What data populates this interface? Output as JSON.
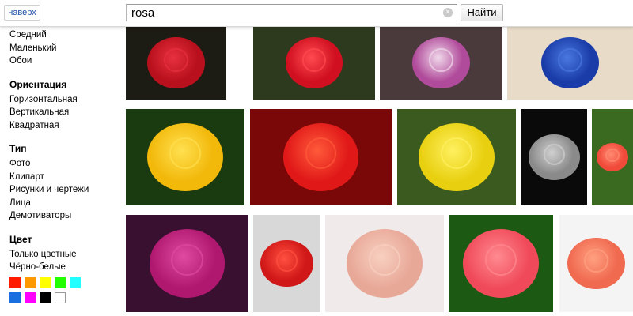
{
  "header": {
    "up_label": "наверх",
    "search_value": "rosa",
    "clear_glyph": "×",
    "search_button": "Найти"
  },
  "sidebar": {
    "size_items": [
      "Средний",
      "Маленький",
      "Обои"
    ],
    "orientation": {
      "title": "Ориентация",
      "items": [
        "Горизонтальная",
        "Вертикальная",
        "Квадратная"
      ]
    },
    "type": {
      "title": "Тип",
      "items": [
        "Фото",
        "Клипарт",
        "Рисунки и чертежи",
        "Лица",
        "Демотиваторы"
      ]
    },
    "color": {
      "title": "Цвет",
      "items": [
        "Только цветные",
        "Чёрно-белые"
      ],
      "swatches": [
        "#ff1a00",
        "#ff9900",
        "#ffff00",
        "#22ff00",
        "#22ffff",
        "#1a6fe0",
        "#ff00ff",
        "#000000",
        "#ffffff"
      ]
    }
  },
  "results": [
    {
      "name": "dark-red-rose",
      "bg": "#1c1c14",
      "rose": "#b8101c",
      "hi": "#e83040"
    },
    {
      "name": "red-rose-dew",
      "bg": "#2e3a1e",
      "rose": "#d01020",
      "hi": "#ff4a50"
    },
    {
      "name": "purple-white-roses",
      "bg": "#4a3a3c",
      "rose": "#b04a9a",
      "hi": "#f0d8ea"
    },
    {
      "name": "blue-rose",
      "bg": "#e8dcc8",
      "rose": "#1a3ca8",
      "hi": "#4a78e0"
    },
    {
      "name": "yellow-rose",
      "bg": "#1a3a10",
      "rose": "#f2b80a",
      "hi": "#ffe050"
    },
    {
      "name": "red-roses-bouquet",
      "bg": "#7a0808",
      "rose": "#e01818",
      "hi": "#ff5a3a"
    },
    {
      "name": "yellow-roses-garden",
      "bg": "#3a5a20",
      "rose": "#e8d010",
      "hi": "#fff060"
    },
    {
      "name": "black-white-rose",
      "bg": "#0a0a0a",
      "rose": "#8a8a8a",
      "hi": "#d0d0d0"
    },
    {
      "name": "coral-rose-dew",
      "bg": "#3a6a20",
      "rose": "#f04a3a",
      "hi": "#ff8a70"
    },
    {
      "name": "magenta-rose",
      "bg": "#3a1030",
      "rose": "#b01870",
      "hi": "#e04aa0"
    },
    {
      "name": "red-rose-branch",
      "bg": "#d8d8d8",
      "rose": "#d01818",
      "hi": "#ff5040"
    },
    {
      "name": "pink-rose-jewelry",
      "bg": "#f0eaea",
      "rose": "#e8a898",
      "hi": "#f8d0c0"
    },
    {
      "name": "pink-rose-leaves",
      "bg": "#1c5a14",
      "rose": "#f04a5a",
      "hi": "#ff8a90"
    },
    {
      "name": "salmon-rose",
      "bg": "#f4f4f4",
      "rose": "#f06a50",
      "hi": "#ffa080"
    }
  ]
}
